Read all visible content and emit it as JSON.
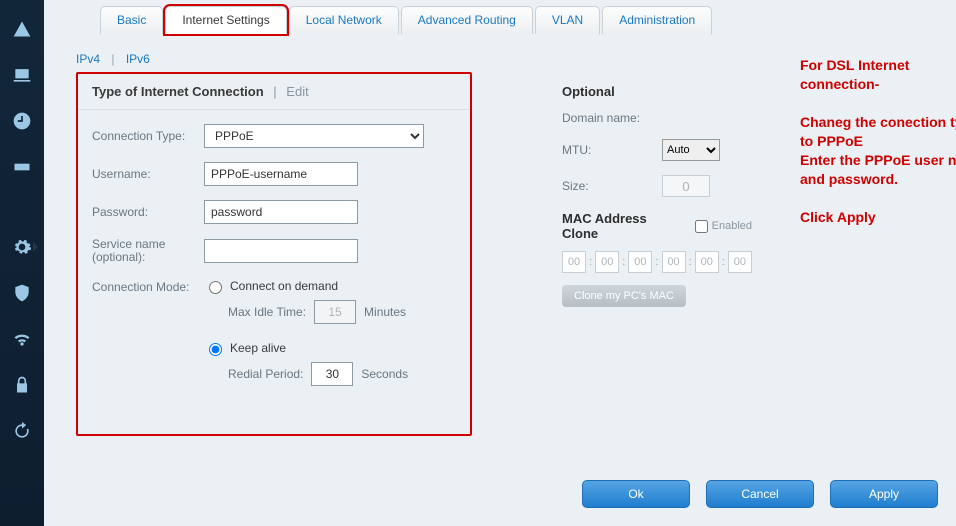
{
  "tabs": {
    "items": [
      {
        "label": "Basic"
      },
      {
        "label": "Internet Settings"
      },
      {
        "label": "Local Network"
      },
      {
        "label": "Advanced Routing"
      },
      {
        "label": "VLAN"
      },
      {
        "label": "Administration"
      }
    ]
  },
  "subtabs": {
    "ipv4": "IPv4",
    "ipv6": "IPv6"
  },
  "left": {
    "title": "Type of Internet Connection",
    "title_sep": "|",
    "edit": "Edit",
    "conn_type_lbl": "Connection Type:",
    "conn_type_val": "PPPoE",
    "username_lbl": "Username:",
    "username_val": "PPPoE-username",
    "password_lbl": "Password:",
    "password_val": "password",
    "service_lbl_1": "Service name",
    "service_lbl_2": "(optional):",
    "service_val": "",
    "conn_mode_lbl": "Connection Mode:",
    "opt_demand": "Connect on demand",
    "max_idle_lbl": "Max Idle Time:",
    "max_idle_val": "15",
    "minutes": "Minutes",
    "opt_keep": "Keep alive",
    "redial_lbl": "Redial Period:",
    "redial_val": "30",
    "seconds": "Seconds"
  },
  "right": {
    "optional": "Optional",
    "domain_lbl": "Domain name:",
    "mtu_lbl": "MTU:",
    "mtu_val": "Auto",
    "size_lbl": "Size:",
    "size_val": "0",
    "mac_head": "MAC Address Clone",
    "enabled": "Enabled",
    "mac": [
      "00",
      "00",
      "00",
      "00",
      "00",
      "00"
    ],
    "clone_btn": "Clone my PC's MAC"
  },
  "annotation": "For DSL Internet connection-\n\nChaneg the conection type to PPPoE\nEnter the PPPoE user name and password.\n\nClick Apply",
  "buttons": {
    "ok": "Ok",
    "cancel": "Cancel",
    "apply": "Apply"
  },
  "icons": {
    "alert": "alert-icon",
    "device": "device-icon",
    "clock": "clock-icon",
    "drive": "drive-icon",
    "gear": "gear-icon",
    "shield": "shield-icon",
    "wifi": "wifi-icon",
    "lock": "lock-icon",
    "refresh": "refresh-icon"
  }
}
